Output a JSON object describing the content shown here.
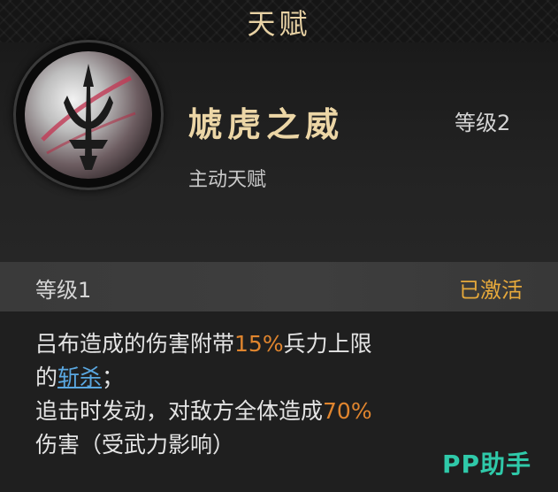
{
  "header": {
    "title": "天赋"
  },
  "talent": {
    "name": "虓虎之威",
    "level": "等级2",
    "type": "主动天赋",
    "icon": "trident-emblem-icon"
  },
  "level_bar": {
    "label": "等级1",
    "status": "已激活"
  },
  "description": {
    "line1_part1": "吕布造成的伤害附带",
    "line1_pct": "15%",
    "line1_part2": "兵力上限",
    "line2_prefix": "的",
    "line2_link": "斩杀",
    "line2_suffix": "；",
    "line3_part1": "追击时发动，对敌方全体造成",
    "line3_pct": "70%",
    "line4": "伤害（受武力影响）"
  },
  "watermark": "PP助手",
  "colors": {
    "gold": "#ecd6a6",
    "orange": "#e0852e",
    "link": "#5aa7e0",
    "status": "#e6a93b",
    "watermark": "#2fc9a9"
  }
}
